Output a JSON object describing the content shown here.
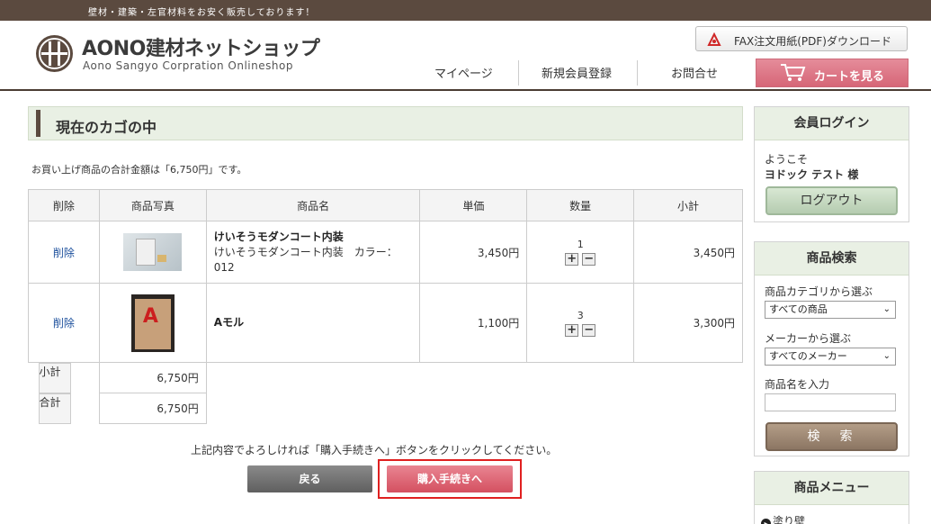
{
  "topbar": {
    "text": "壁材・建築・左官材料をお安く販売しております！"
  },
  "header": {
    "logo_title": "AONO建材ネットショップ",
    "logo_sub": "Aono Sangyo Corpration Onlineshop",
    "fax_label": "FAX注文用紙(PDF)ダウンロード",
    "nav": {
      "mypage": "マイページ",
      "register": "新規会員登録",
      "contact": "お問合せ"
    },
    "cart_label": "カートを見る"
  },
  "main": {
    "section_title": "現在のカゴの中",
    "total_message": "お買い上げ商品の合計金額は「6,750円」です。",
    "columns": [
      "削除",
      "商品写真",
      "商品名",
      "単価",
      "数量",
      "小計"
    ],
    "items": [
      {
        "delete": "削除",
        "name": "けいそうモダンコート内装",
        "detail": "けいそうモダンコート内装　カラー：012",
        "price": "3,450円",
        "qty": "1",
        "subtotal": "3,450円"
      },
      {
        "delete": "削除",
        "name": "Aモル",
        "detail": "",
        "price": "1,100円",
        "qty": "3",
        "subtotal": "3,300円"
      }
    ],
    "summary": {
      "subtotal_label": "小計",
      "subtotal_value": "6,750円",
      "total_label": "合計",
      "total_value": "6,750円"
    },
    "qty_plus": "+",
    "qty_minus": "−",
    "confirm_message": "上記内容でよろしければ「購入手続きへ」ボタンをクリックしてください。",
    "back_label": "戻る",
    "buy_label": "購入手続きへ"
  },
  "sidebar": {
    "login": {
      "title": "会員ログイン",
      "welcome": "ようこそ",
      "user": "ヨドック テスト 様",
      "logout": "ログアウト"
    },
    "search": {
      "title": "商品検索",
      "category_label": "商品カテゴリから選ぶ",
      "category_value": "すべての商品",
      "maker_label": "メーカーから選ぶ",
      "maker_value": "すべてのメーカー",
      "name_label": "商品名を入力",
      "name_value": "",
      "button": "検　索"
    },
    "menu": {
      "title": "商品メニュー",
      "first_item": "塗り壁"
    }
  },
  "colors": {
    "brand": "#5b4a3f",
    "accent_pink": "#d66677",
    "section_bg": "#e9f0e4",
    "highlight": "#e02020"
  }
}
